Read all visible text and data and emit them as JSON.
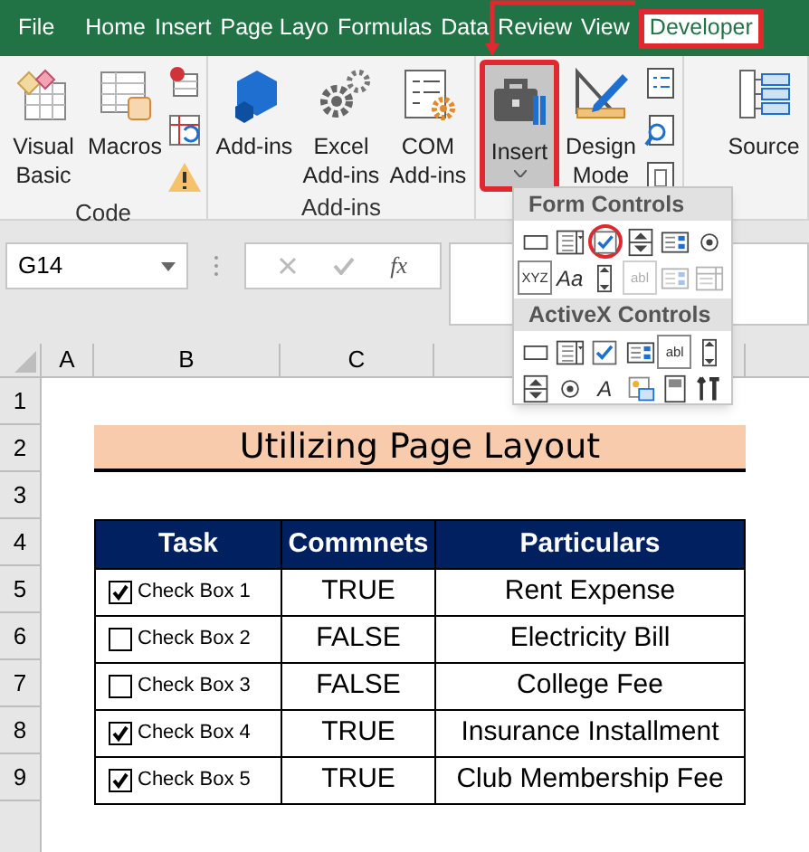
{
  "tabs": [
    {
      "label": "File",
      "selected": false
    },
    {
      "label": "Home",
      "selected": false
    },
    {
      "label": "Insert",
      "selected": false
    },
    {
      "label": "Page Layo",
      "selected": false
    },
    {
      "label": "Formulas",
      "selected": false
    },
    {
      "label": "Data",
      "selected": false
    },
    {
      "label": "Review",
      "selected": false
    },
    {
      "label": "View",
      "selected": false
    },
    {
      "label": "Developer",
      "selected": true,
      "annotated": true
    }
  ],
  "ribbon": {
    "groups": [
      {
        "label": "Code",
        "buttons": [
          {
            "kind": "visual-basic",
            "label": "Visual Basic"
          },
          {
            "kind": "macros",
            "label": "Macros"
          }
        ],
        "small_buttons": [
          {
            "kind": "record"
          },
          {
            "kind": "relative"
          },
          {
            "kind": "security"
          }
        ]
      },
      {
        "label": "Add-ins",
        "buttons": [
          {
            "kind": "add-ins",
            "label": "Add-ins"
          },
          {
            "kind": "excel-add-ins",
            "label": "Excel Add-ins"
          },
          {
            "kind": "com-add-ins",
            "label": "COM Add-ins"
          }
        ]
      },
      {
        "buttons": [
          {
            "kind": "insert",
            "label": "Insert",
            "selected": true,
            "annotated": true
          },
          {
            "kind": "design-mode",
            "label": "Design Mode",
            "selected": false
          }
        ],
        "small_buttons": [
          {
            "kind": "properties"
          },
          {
            "kind": "view-code"
          },
          {
            "kind": "run-dialog"
          }
        ]
      },
      {
        "buttons": [
          {
            "kind": "source",
            "label": "Source"
          }
        ]
      }
    ]
  },
  "formula_bar": {
    "name_box": "G14",
    "function_label": "fx"
  },
  "columns": [
    "A",
    "B",
    "C"
  ],
  "row_numbers": [
    "1",
    "2",
    "3",
    "4",
    "5",
    "6",
    "7",
    "8",
    "9"
  ],
  "sheet": {
    "title": "Utilizing Page Layout",
    "table": {
      "columns": [
        "Task",
        "Commnets",
        "Particulars"
      ],
      "rows": [
        {
          "task": "Check Box 1",
          "checked": true,
          "comment": "TRUE",
          "particular": "Rent Expense"
        },
        {
          "task": "Check Box 2",
          "checked": false,
          "comment": "FALSE",
          "particular": "Electricity Bill"
        },
        {
          "task": "Check Box 3",
          "checked": false,
          "comment": "FALSE",
          "particular": "College Fee"
        },
        {
          "task": "Check Box 4",
          "checked": true,
          "comment": "TRUE",
          "particular": "Insurance Installment"
        },
        {
          "task": "Check Box 5",
          "checked": true,
          "comment": "TRUE",
          "particular": "Club Membership Fee"
        }
      ]
    }
  },
  "dropdown": {
    "sections": [
      {
        "title": "Form Controls",
        "controls": [
          {
            "kind": "button",
            "disabled": false
          },
          {
            "kind": "combo",
            "disabled": false
          },
          {
            "kind": "checkbox",
            "disabled": false,
            "annotated": true
          },
          {
            "kind": "spin",
            "disabled": false
          },
          {
            "kind": "listbox",
            "disabled": false
          },
          {
            "kind": "option",
            "disabled": false
          },
          {
            "kind": "groupbox",
            "glyph": "XYZ",
            "disabled": false
          },
          {
            "kind": "label",
            "glyph": "Aa",
            "disabled": false
          },
          {
            "kind": "scrollbar",
            "disabled": false
          },
          {
            "kind": "textfield",
            "glyph": "abl",
            "disabled": true
          },
          {
            "kind": "listbox",
            "disabled": true
          },
          {
            "kind": "combolist",
            "disabled": true
          }
        ]
      },
      {
        "title": "ActiveX Controls",
        "controls": [
          {
            "kind": "button",
            "disabled": false
          },
          {
            "kind": "combo",
            "disabled": false
          },
          {
            "kind": "checkbox",
            "disabled": false
          },
          {
            "kind": "listbox",
            "disabled": false
          },
          {
            "kind": "textfield",
            "glyph": "abl",
            "disabled": false
          },
          {
            "kind": "scrollbar",
            "disabled": false
          },
          {
            "kind": "spin",
            "disabled": false
          },
          {
            "kind": "option",
            "disabled": false
          },
          {
            "kind": "label",
            "glyph": "A",
            "disabled": false
          },
          {
            "kind": "image",
            "disabled": false
          },
          {
            "kind": "toggle",
            "disabled": false
          },
          {
            "kind": "more",
            "disabled": false
          }
        ]
      }
    ]
  }
}
